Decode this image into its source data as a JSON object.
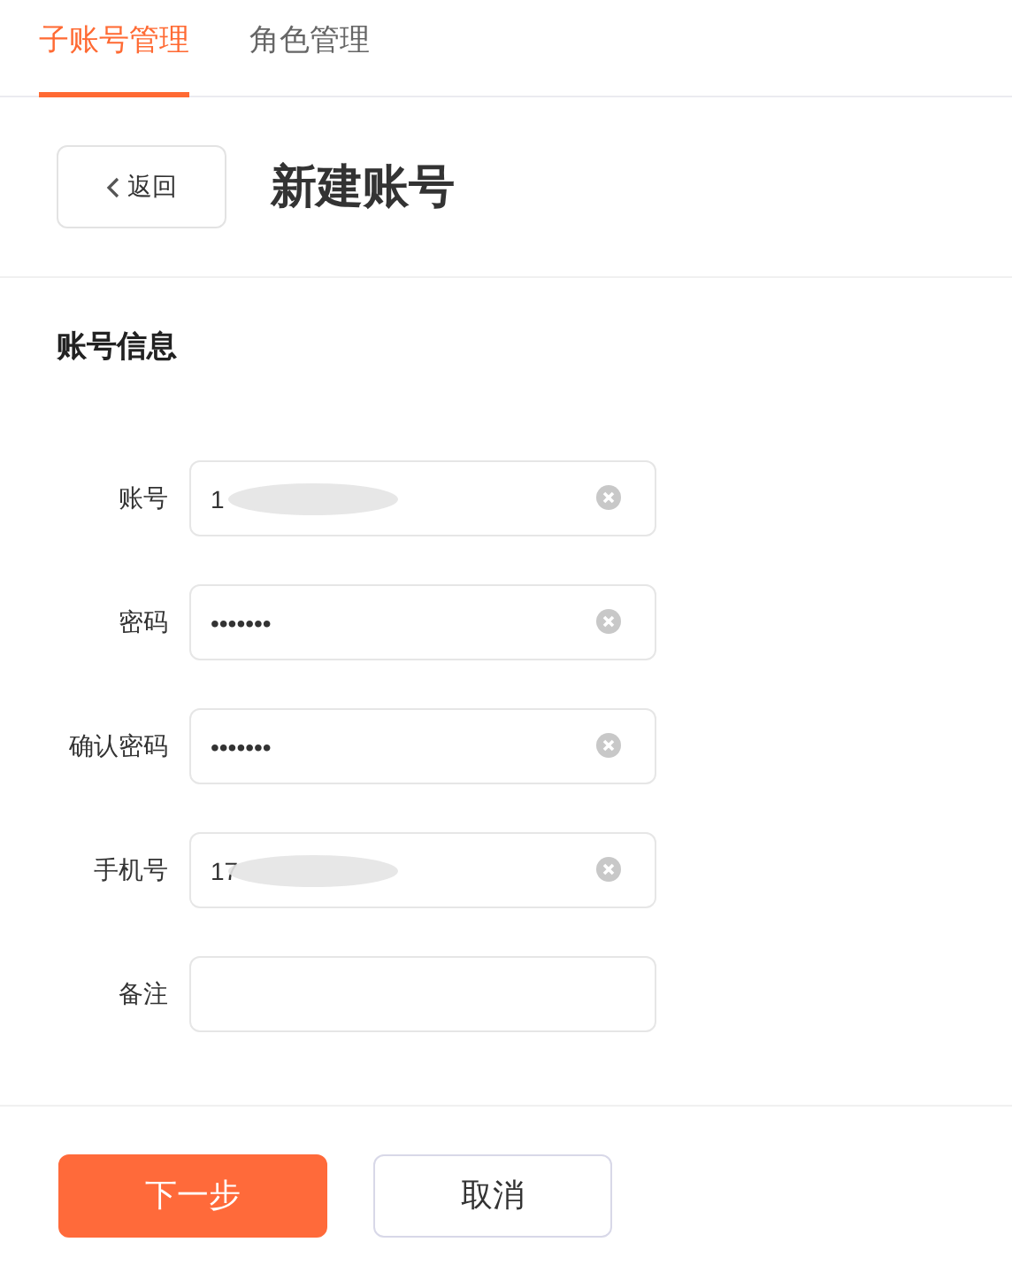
{
  "tabs": [
    {
      "label": "子账号管理",
      "selected": true
    },
    {
      "label": "角色管理",
      "selected": false
    }
  ],
  "back_button": "返回",
  "page_title": "新建账号",
  "section_title": "账号信息",
  "fields": [
    {
      "label": "账号",
      "value": "1",
      "clearable": true,
      "redacted": true
    },
    {
      "label": "密码",
      "value": "•••••••",
      "clearable": true,
      "redacted": false
    },
    {
      "label": "确认密码",
      "value": "•••••••",
      "clearable": true,
      "redacted": false
    },
    {
      "label": "手机号",
      "value": "17",
      "clearable": true,
      "redacted": true
    },
    {
      "label": "备注",
      "clearable": false,
      "redacted": false
    }
  ],
  "buttons": [
    {
      "label": "下一步",
      "kind": "primary"
    },
    {
      "label": "取消",
      "kind": "secondary"
    }
  ]
}
